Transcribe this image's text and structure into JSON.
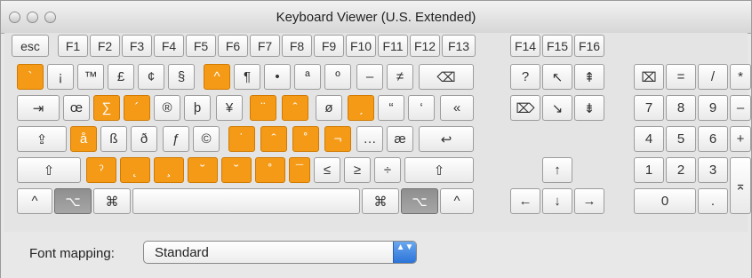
{
  "window": {
    "title": "Keyboard Viewer (U.S. Extended)"
  },
  "colors": {
    "dead_key": "#f49a16",
    "pressed_key": "#8f8f8f",
    "select_accent": "#2c74d9"
  },
  "keyboard": {
    "fn_row": [
      "esc",
      "F1",
      "F2",
      "F3",
      "F4",
      "F5",
      "F6",
      "F7",
      "F8",
      "F9",
      "F10",
      "F11",
      "F12",
      "F13"
    ],
    "fn_row_right": [
      "F14",
      "F15",
      "F16"
    ],
    "row1": [
      "`",
      "¡",
      "™",
      "£",
      "¢",
      "§",
      "^",
      "¶",
      "•",
      "ª",
      "º",
      "–",
      "≠",
      "⌫"
    ],
    "row2": [
      "⇥",
      "œ",
      "∑",
      "´",
      "®",
      "þ",
      "¥",
      "¨",
      "ˆ",
      "ø",
      "ˏ",
      "“",
      "‘",
      "«"
    ],
    "row3": [
      "⇪",
      "å",
      "ß",
      "ð",
      "ƒ",
      "©",
      "˙",
      "ˆ",
      "˚",
      "¬",
      "…",
      "æ",
      "↩"
    ],
    "row4": [
      "⇧",
      "ˀ",
      "˛",
      "¸",
      "˘",
      "˘",
      "˚",
      "¯",
      "≤",
      "≥",
      "÷",
      "⇧"
    ],
    "row5": [
      "^",
      "⌥",
      "⌘",
      "",
      "⌘",
      "⌥",
      "^"
    ],
    "nav_row1": [
      "?",
      "↖",
      "⇞"
    ],
    "nav_row2": [
      "⌦",
      "↘",
      "⇟"
    ],
    "arrow_up": "↑",
    "arrows": [
      "←",
      "↓",
      "→"
    ],
    "numpad_row1": [
      "⌧",
      "=",
      "/",
      "*"
    ],
    "numpad_row2": [
      "7",
      "8",
      "9",
      "–"
    ],
    "numpad_row3": [
      "4",
      "5",
      "6",
      "+"
    ],
    "numpad_row4": [
      "1",
      "2",
      "3"
    ],
    "numpad_row5": [
      "0",
      "."
    ],
    "numpad_enter": "⌅"
  },
  "footer": {
    "font_mapping_label": "Font mapping:",
    "font_mapping_value": "Standard",
    "select_arrows": "▲▼"
  }
}
